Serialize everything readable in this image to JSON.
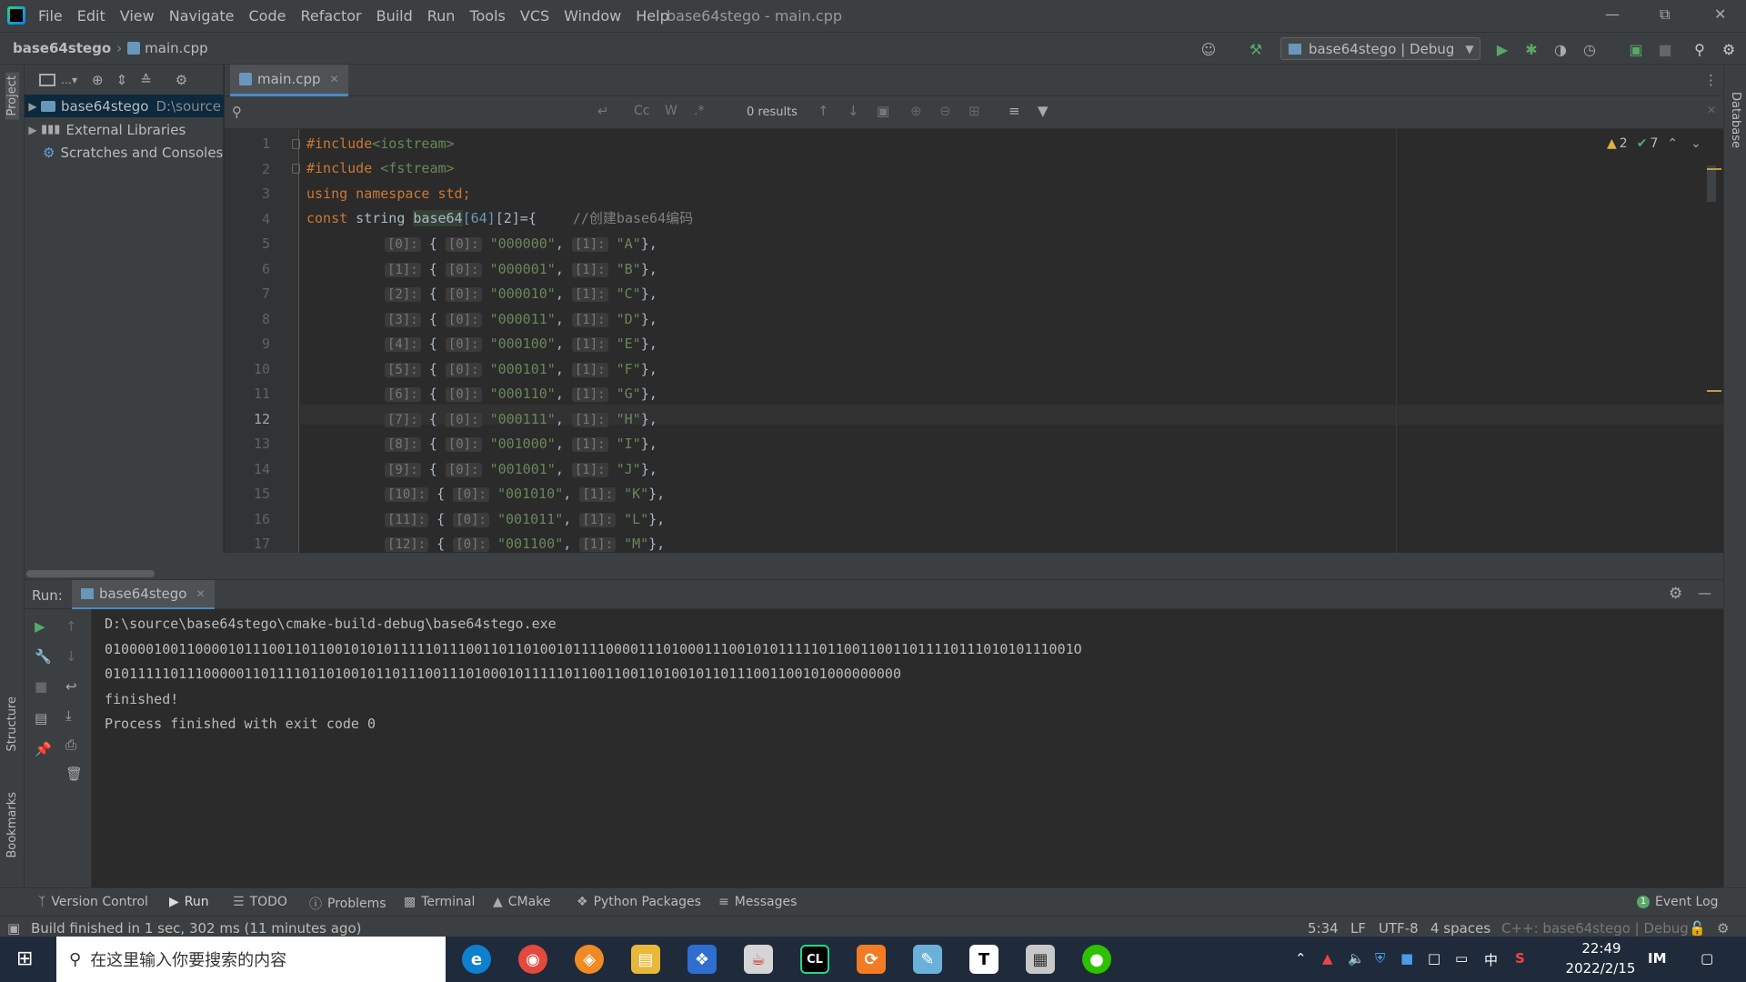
{
  "menubar": {
    "items": [
      "File",
      "Edit",
      "View",
      "Navigate",
      "Code",
      "Refactor",
      "Build",
      "Run",
      "Tools",
      "VCS",
      "Window",
      "Help"
    ],
    "window_title": "base64stego - main.cpp"
  },
  "navbar": {
    "project": "base64stego",
    "file": "main.cpp",
    "run_config": "base64stego | Debug"
  },
  "left_strip": {
    "project": "Project",
    "structure": "Structure",
    "bookmarks": "Bookmarks"
  },
  "right_strip": {
    "database": "Database"
  },
  "project_tree": {
    "items": [
      {
        "label": "base64stego",
        "path": "D:\\source"
      },
      {
        "label": "External Libraries"
      },
      {
        "label": "Scratches and Consoles"
      }
    ]
  },
  "editor": {
    "tab": "main.cpp",
    "search_results": "0 results",
    "search_opts": {
      "cc": "Cc",
      "w": "W",
      "regex": ".*"
    },
    "warnings": "2",
    "weak_warnings": "7",
    "line_numbers": [
      "1",
      "2",
      "3",
      "4",
      "5",
      "6",
      "7",
      "8",
      "9",
      "10",
      "11",
      "12",
      "13",
      "14",
      "15",
      "16",
      "17"
    ],
    "current_line": "12",
    "lines": {
      "l1": {
        "kw": "#include",
        "str": "<iostream>"
      },
      "l2": {
        "kw": "#include",
        "str": " <fstream>"
      },
      "l3": {
        "kw1": "using",
        "kw2": " namespace",
        "text": " std;"
      },
      "l4": {
        "kw": "const",
        "text1": " string ",
        "ident": "base64",
        "num1": "[64]",
        "text2": "[2]={",
        "comment": "//创建base64编码"
      },
      "rows": [
        {
          "i": "[0]:",
          "a": "\"000000\"",
          "b": "\"A\""
        },
        {
          "i": "[1]:",
          "a": "\"000001\"",
          "b": "\"B\""
        },
        {
          "i": "[2]:",
          "a": "\"000010\"",
          "b": "\"C\""
        },
        {
          "i": "[3]:",
          "a": "\"000011\"",
          "b": "\"D\""
        },
        {
          "i": "[4]:",
          "a": "\"000100\"",
          "b": "\"E\""
        },
        {
          "i": "[5]:",
          "a": "\"000101\"",
          "b": "\"F\""
        },
        {
          "i": "[6]:",
          "a": "\"000110\"",
          "b": "\"G\""
        },
        {
          "i": "[7]:",
          "a": "\"000111\"",
          "b": "\"H\""
        },
        {
          "i": "[8]:",
          "a": "\"001000\"",
          "b": "\"I\""
        },
        {
          "i": "[9]:",
          "a": "\"001001\"",
          "b": "\"J\""
        },
        {
          "i": "[10]:",
          "a": "\"001010\"",
          "b": "\"K\""
        },
        {
          "i": "[11]:",
          "a": "\"001011\"",
          "b": "\"L\""
        },
        {
          "i": "[12]:",
          "a": "\"001100\"",
          "b": "\"M\""
        }
      ],
      "hint0": "[0]:",
      "hint1": "[1]:"
    }
  },
  "run": {
    "label": "Run:",
    "tab": "base64stego",
    "output": [
      "D:\\source\\base64stego\\cmake-build-debug\\base64stego.exe",
      "0100001001100001011100110110010101011111011100110110100101111000011101000111001010111110110011001101111011101010111001O",
      "0101111101110000011011110110100101101110011101000101111101100110011010010110111001100101000000000",
      "finished!",
      "Process finished with exit code 0"
    ]
  },
  "tool_tabs": [
    "Version Control",
    "Run",
    "TODO",
    "Problems",
    "Terminal",
    "CMake",
    "Python Packages",
    "Messages"
  ],
  "event_log": "Event Log",
  "event_log_count": "1",
  "status": {
    "message": "Build finished in 1 sec, 302 ms (11 minutes ago)",
    "position": "5:34",
    "line_sep": "LF",
    "encoding": "UTF-8",
    "indent": "4 spaces",
    "context": "C++: base64stego | Debug"
  },
  "taskbar": {
    "search_placeholder": "在这里输入你要搜索的内容",
    "time": "22:49",
    "date": "2022/2/15",
    "ime": "中",
    "ime2": "S",
    "t_app": "T",
    "cl_app": "CL"
  },
  "colors": {
    "accent": "#4a88c7",
    "keyword": "#cc7832",
    "string": "#6a8759",
    "run_green": "#59a869"
  }
}
